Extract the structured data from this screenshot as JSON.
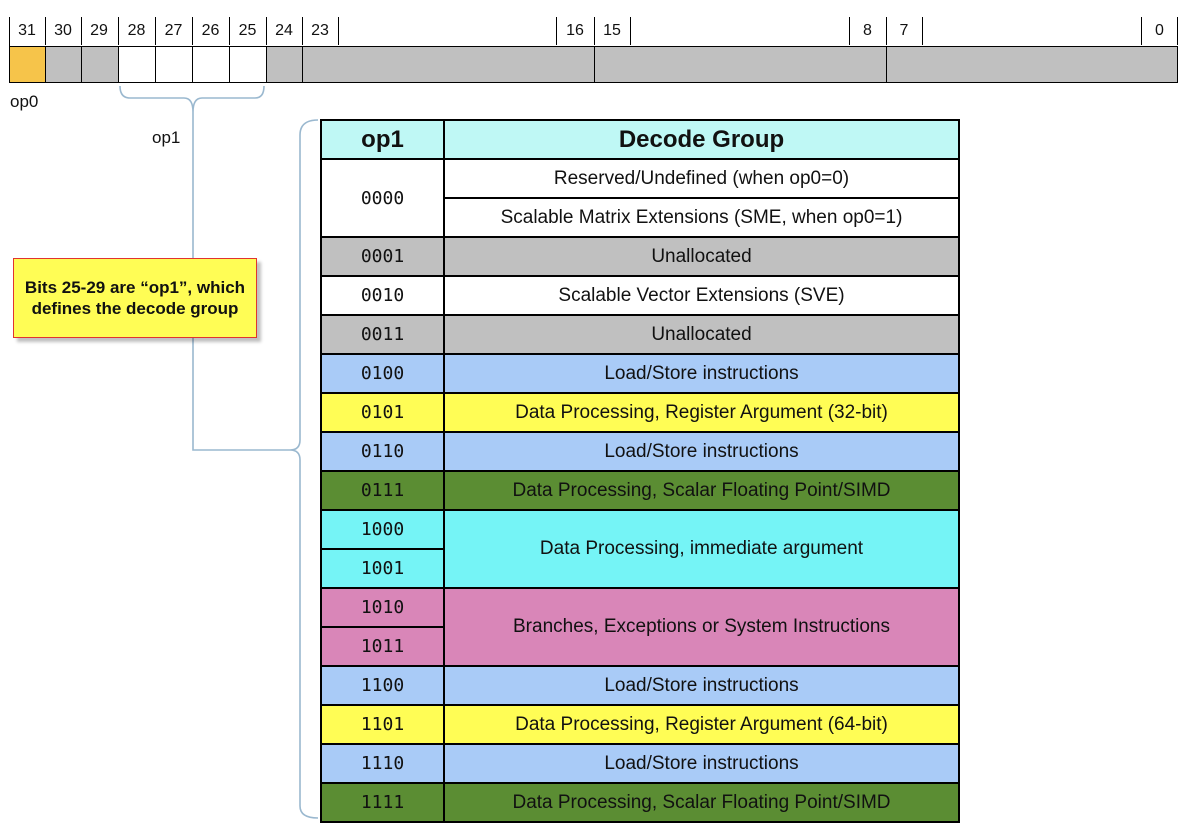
{
  "bit_strip": {
    "bit_labels": [
      "31",
      "30",
      "29",
      "28",
      "27",
      "26",
      "25",
      "24",
      "23",
      "16",
      "15",
      "8",
      "7",
      "0"
    ],
    "op0_label": "op0",
    "op1_label": "op1"
  },
  "callout": {
    "text": "Bits 25-29 are “op1”, which defines the decode group"
  },
  "table": {
    "headers": [
      "op1",
      "Decode Group"
    ],
    "row_0000": {
      "code": "0000",
      "group_a": "Reserved/Undefined (when op0=0)",
      "group_b": "Scalable Matrix Extensions (SME, when op0=1)"
    },
    "row_0001": {
      "code": "0001",
      "group": "Unallocated"
    },
    "row_0010": {
      "code": "0010",
      "group": "Scalable Vector Extensions (SVE)"
    },
    "row_0011": {
      "code": "0011",
      "group": "Unallocated"
    },
    "row_0100": {
      "code": "0100",
      "group": "Load/Store instructions"
    },
    "row_0101": {
      "code": "0101",
      "group": "Data Processing, Register Argument (32-bit)"
    },
    "row_0110": {
      "code": "0110",
      "group": "Load/Store instructions"
    },
    "row_0111": {
      "code": "0111",
      "group": "Data Processing, Scalar Floating Point/SIMD"
    },
    "row_1000": {
      "code": "1000",
      "group": "Data Processing, immediate argument"
    },
    "row_1001": {
      "code": "1001"
    },
    "row_1010": {
      "code": "1010",
      "group": "Branches, Exceptions or System Instructions"
    },
    "row_1011": {
      "code": "1011"
    },
    "row_1100": {
      "code": "1100",
      "group": "Load/Store instructions"
    },
    "row_1101": {
      "code": "1101",
      "group": "Data Processing, Register Argument (64-bit)"
    },
    "row_1110": {
      "code": "1110",
      "group": "Load/Store instructions"
    },
    "row_1111": {
      "code": "1111",
      "group": "Data Processing, Scalar Floating Point/SIMD"
    }
  },
  "colors": {
    "op0_field": "#f6c44a",
    "reserved_field": "#c0c0c0",
    "header": "#bff8f5",
    "unallocated": "#c0c0c0",
    "load_store": "#a9cbf7",
    "data_processing_register": "#fffd55",
    "scalar_fp_simd": "#5b8d33",
    "immediate": "#75f4f6",
    "branches": "#d986b8",
    "callout_fill": "#fffd55",
    "callout_border": "#e0342f"
  }
}
